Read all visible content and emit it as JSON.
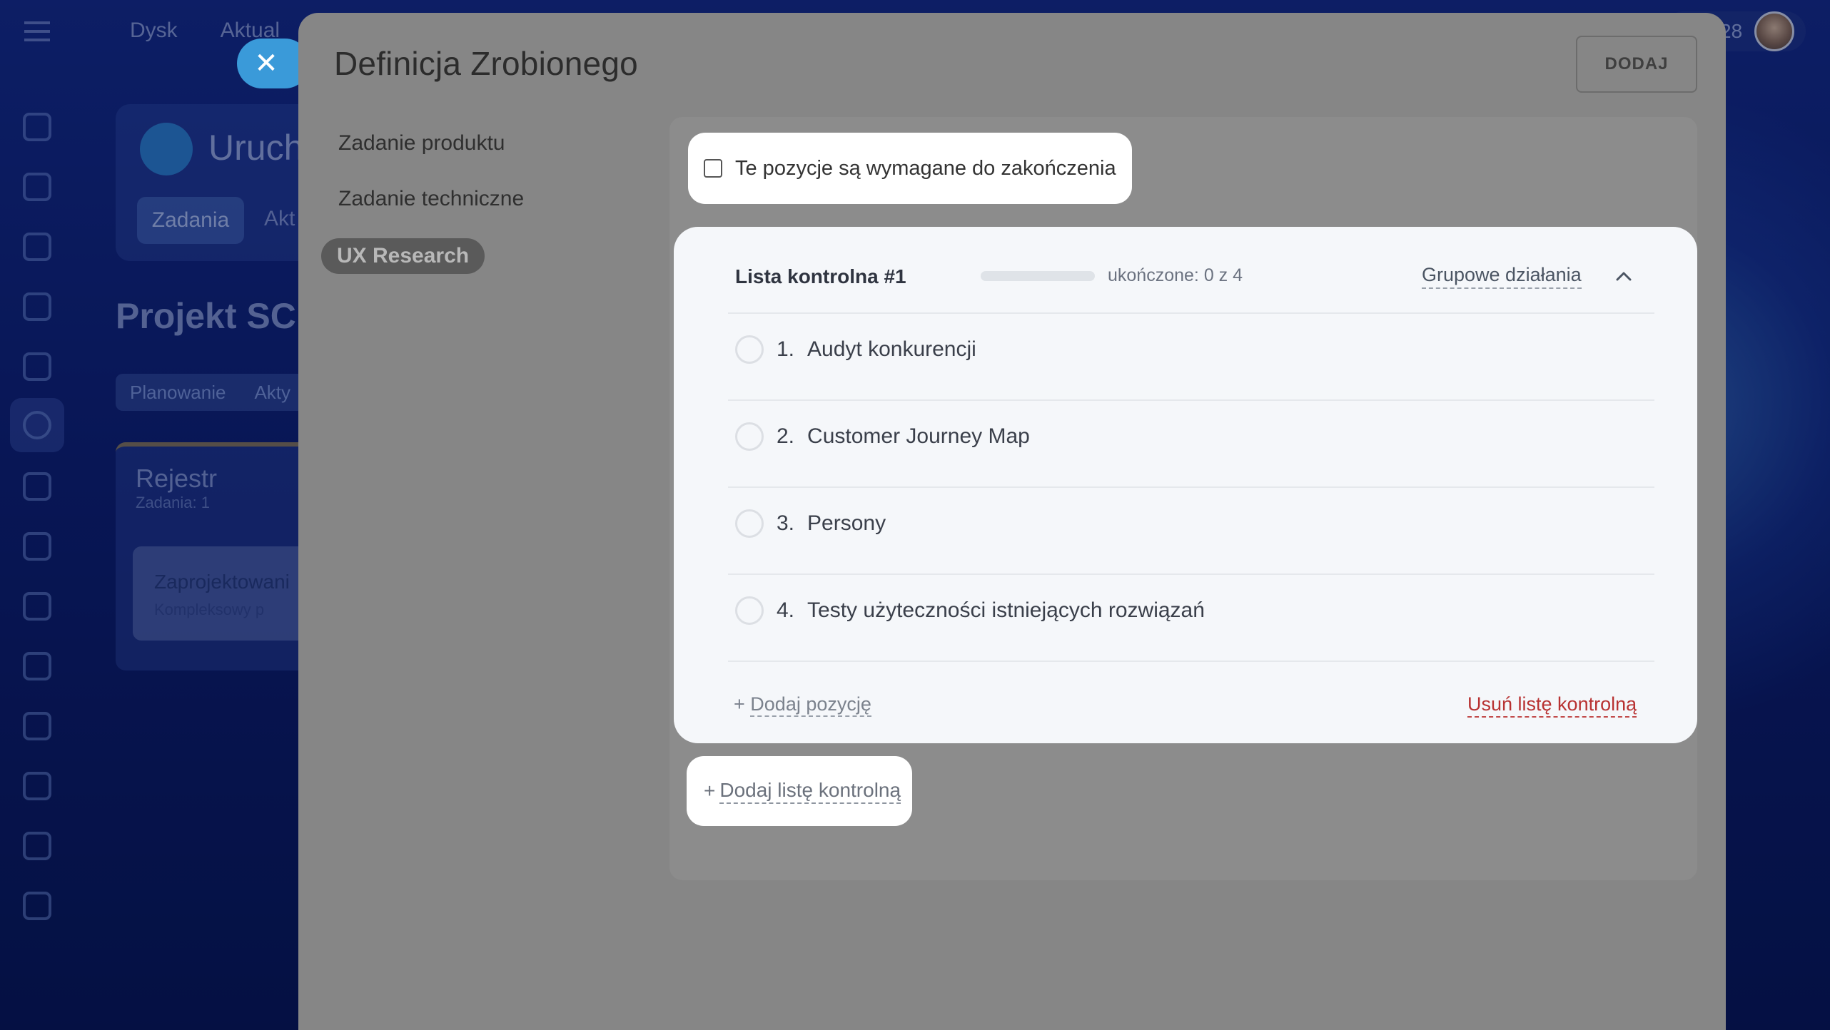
{
  "background": {
    "topnav": [
      "Dysk",
      "Aktual"
    ],
    "project_short": "Uruch",
    "tabs": [
      "Zadania",
      "Akt"
    ],
    "project_title": "Projekt SCR",
    "pills": [
      "Planowanie",
      "Akty"
    ],
    "column_title": "Rejestr",
    "column_sub": "Zadania: 1",
    "task_title": "Zaprojektowani",
    "task_sub": "Kompleksowy p",
    "counter": "28",
    "close_glyph": "✕"
  },
  "modal": {
    "title": "Definicja Zrobionego",
    "add_button": "DODAJ",
    "nav": {
      "items": [
        "Zadanie produktu",
        "Zadanie techniczne"
      ],
      "active": "UX Research"
    },
    "required_label": "Te pozycje są wymagane do zakończenia",
    "checklist": {
      "title": "Lista kontrolna #1",
      "progress_text": "ukończone: 0 z 4",
      "progress_fraction": 0,
      "group_actions": "Grupowe działania",
      "items": [
        {
          "num": "1.",
          "text": "Audyt konkurencji"
        },
        {
          "num": "2.",
          "text": "Customer Journey Map"
        },
        {
          "num": "3.",
          "text": "Persony"
        },
        {
          "num": "4.",
          "text": "Testy użyteczności istniejących rozwiązań"
        }
      ],
      "add_item_prefix": "+",
      "add_item": "Dodaj pozycję",
      "remove": "Usuń listę kontrolną"
    },
    "add_checklist_prefix": "+",
    "add_checklist": "Dodaj listę kontrolną"
  },
  "colors": {
    "modal_bg": "#868686",
    "accent_close": "#3a9ad9",
    "danger": "#b83232"
  }
}
